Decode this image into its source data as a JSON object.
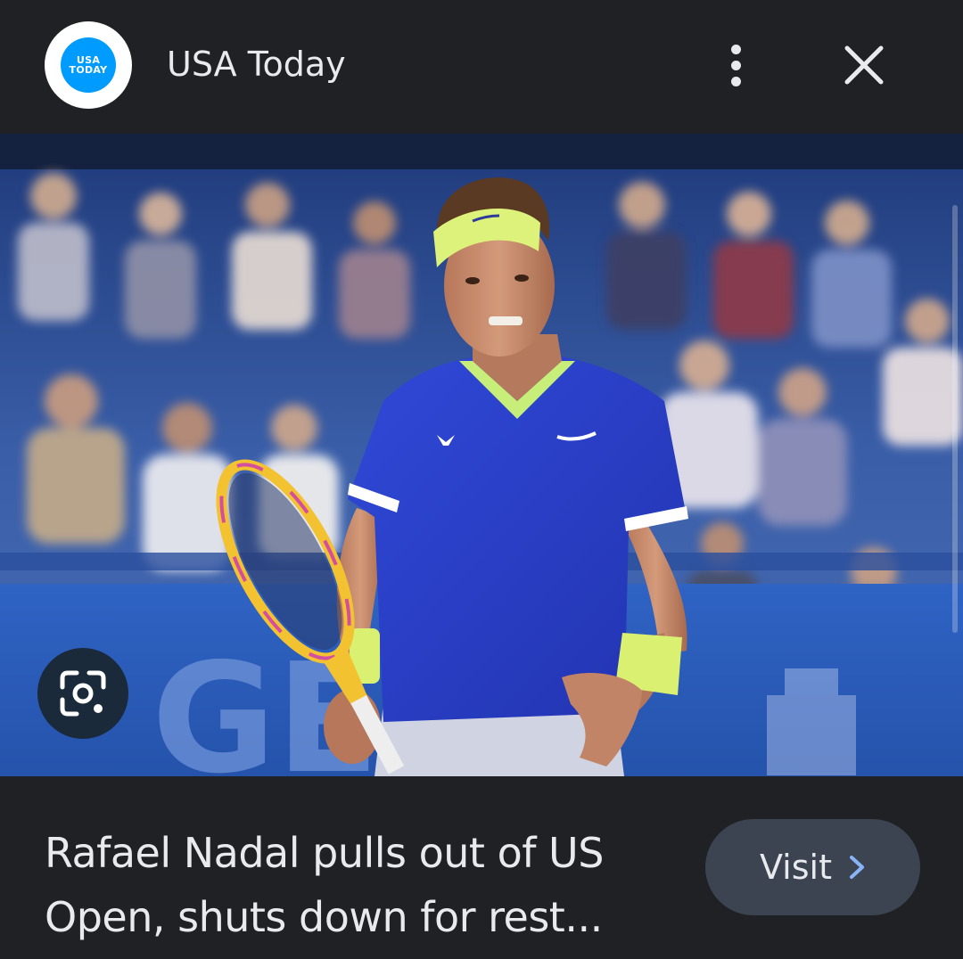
{
  "header": {
    "source_logo": {
      "line1": "USA",
      "line2": "TODAY",
      "color": "#009bff"
    },
    "source_name": "USA Today",
    "more_icon": "more-vert-icon",
    "close_icon": "close-icon"
  },
  "image": {
    "lens_icon": "google-lens-icon",
    "colors": {
      "shirt": "#2a3fd0",
      "headband": "#ddf27a",
      "banner": "#2a5bb8"
    }
  },
  "footer": {
    "headline": "Rafael Nadal pulls out of US Open, shuts down for rest...",
    "visit_label": "Visit",
    "visit_icon": "chevron-right-icon",
    "accent": "#8ab4f8"
  }
}
